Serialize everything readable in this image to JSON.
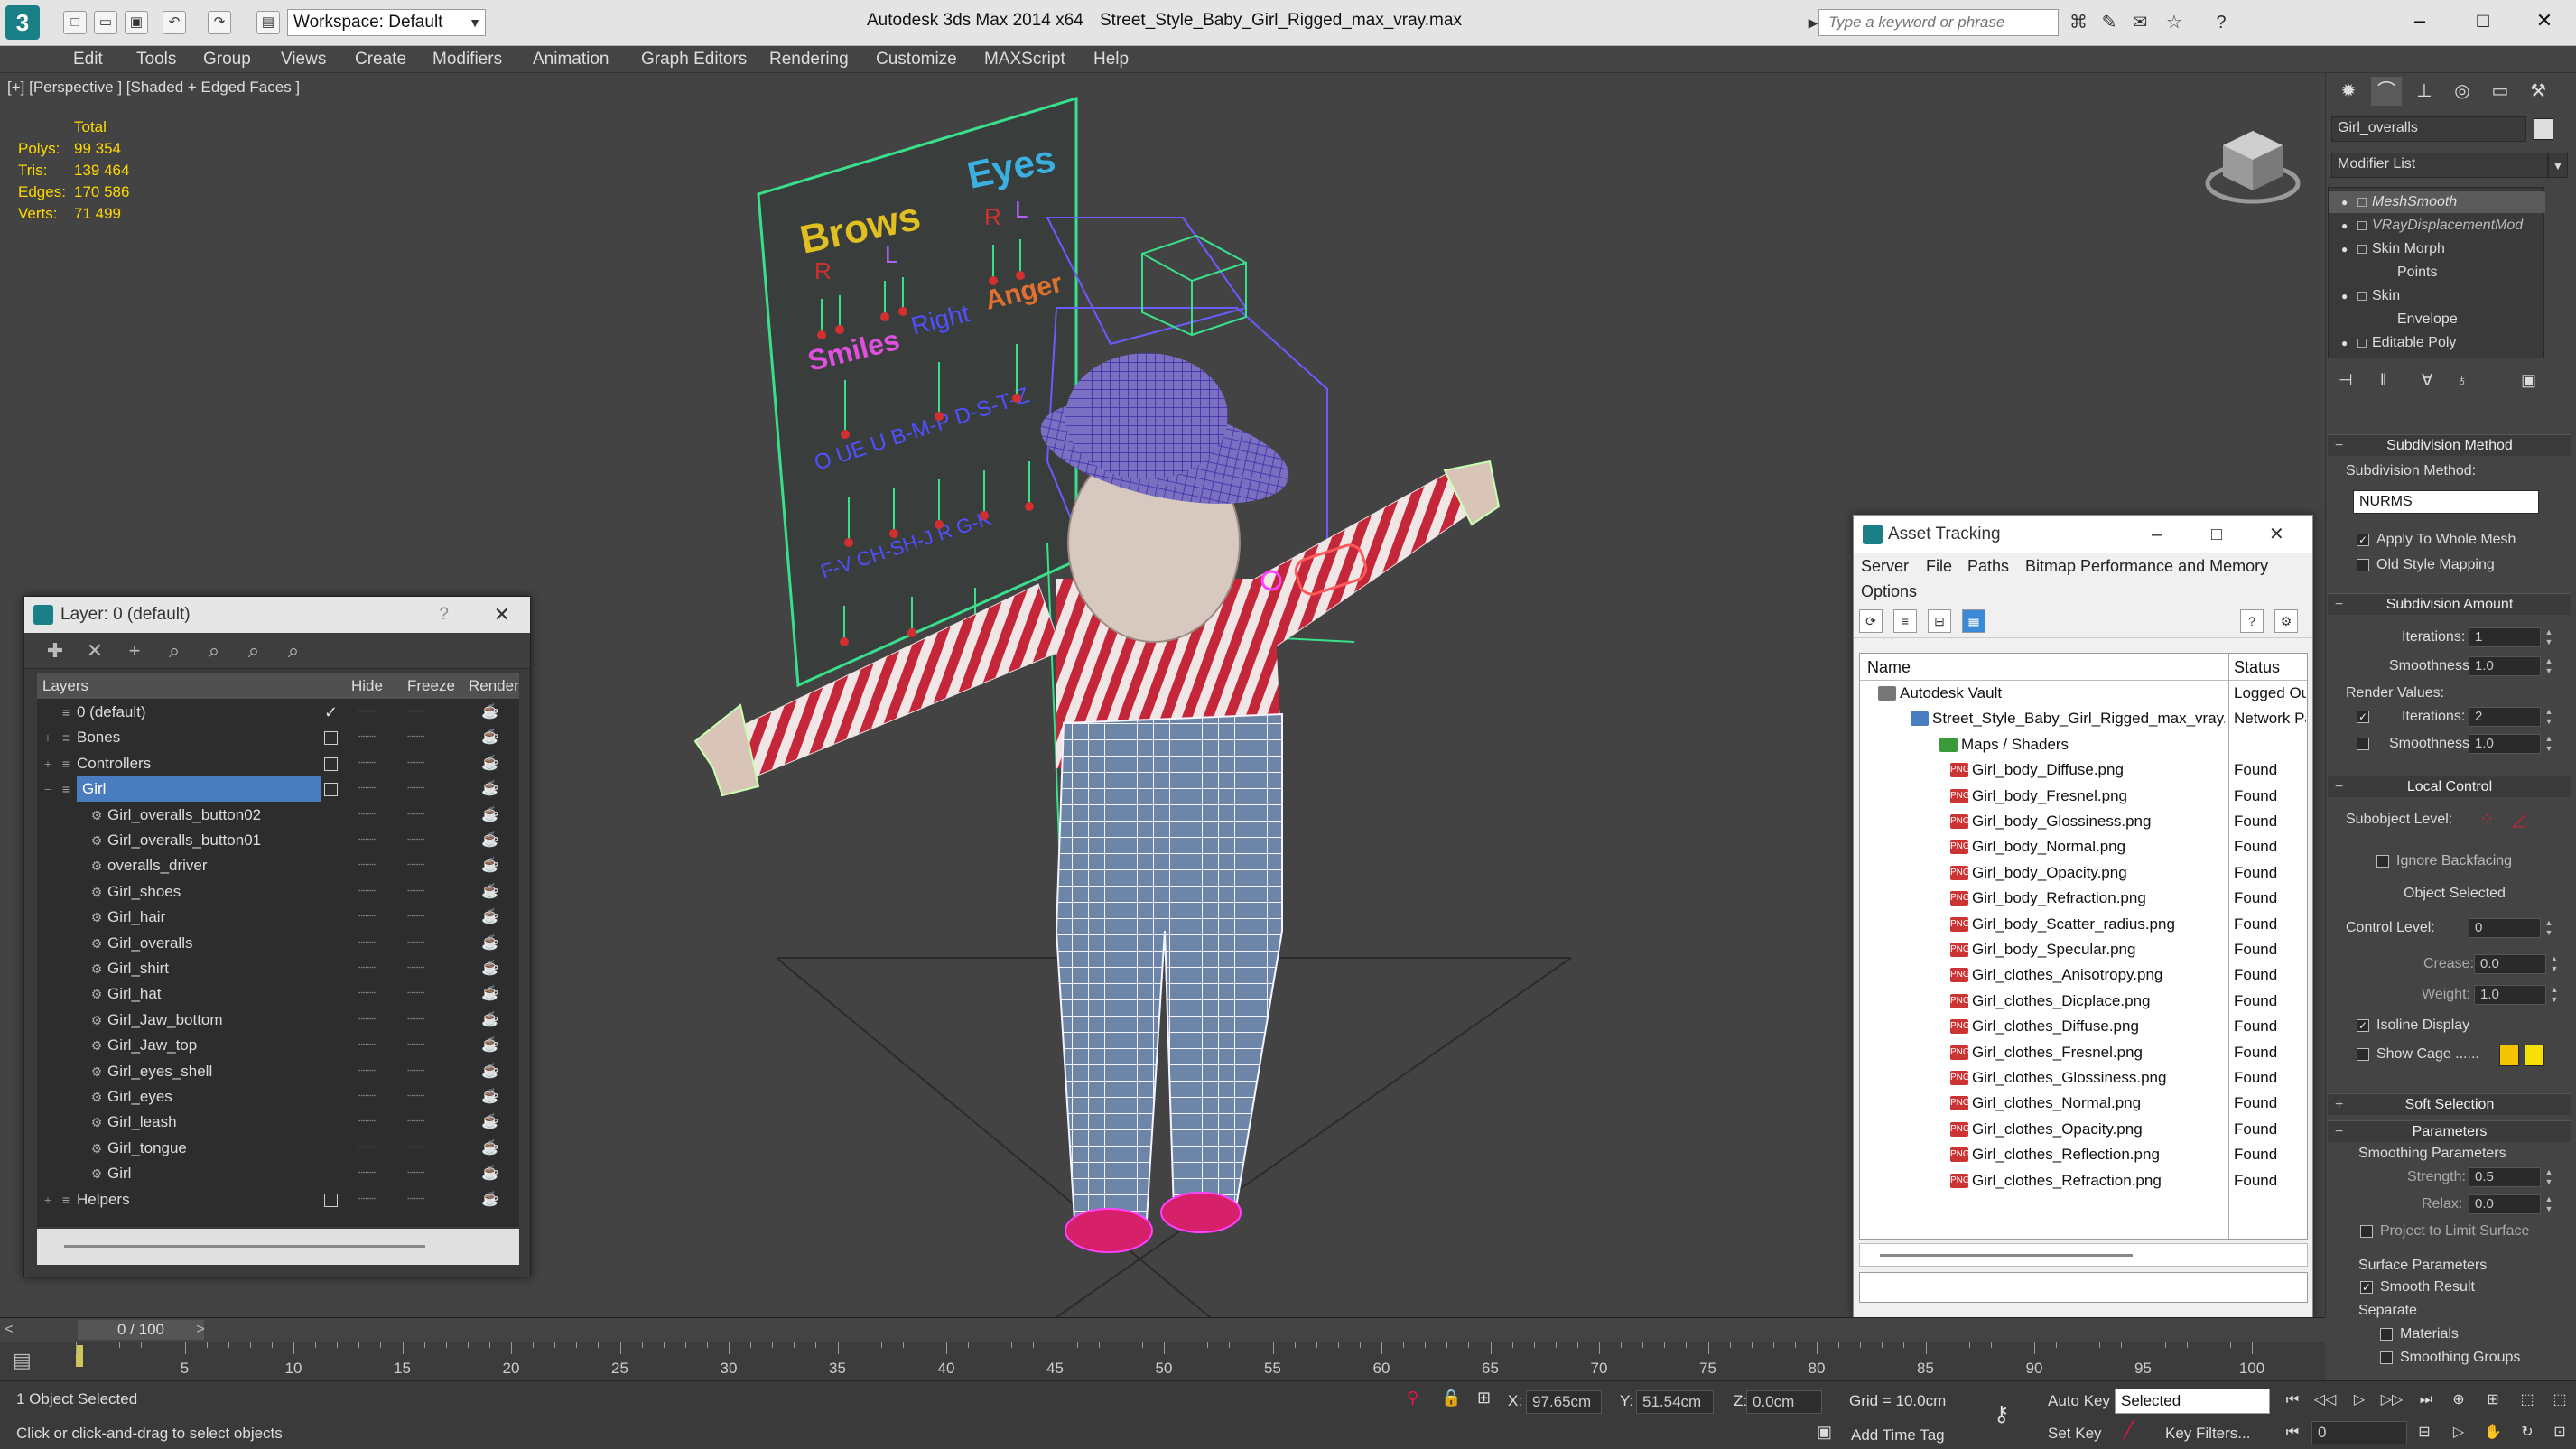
{
  "titlebar": {
    "workspace": "Workspace: Default",
    "app_title": "Autodesk 3ds Max  2014 x64",
    "file_title": "Street_Style_Baby_Girl_Rigged_max_vray.max",
    "search_placeholder": "Type a keyword or phrase"
  },
  "menu": [
    "Edit",
    "Tools",
    "Group",
    "Views",
    "Create",
    "Modifiers",
    "Animation",
    "Graph Editors",
    "Rendering",
    "Customize",
    "MAXScript",
    "Help"
  ],
  "viewport": {
    "label": "[+] [Perspective ] [Shaded + Edged Faces ]",
    "stats": {
      "total": "Total",
      "rows": [
        {
          "k": "Polys:",
          "v": "99 354"
        },
        {
          "k": "Tris:",
          "v": "139 464"
        },
        {
          "k": "Edges:",
          "v": "170 586"
        },
        {
          "k": "Verts:",
          "v": "71 499"
        }
      ]
    },
    "board": {
      "brows": "Brows",
      "eyes": "Eyes",
      "r1": "R",
      "l1": "L",
      "r2": "R",
      "l2": "L",
      "smiles": "Smiles",
      "right": "Right",
      "anger": "Anger",
      "row1": "O  UE  U   B-M-P  D-S-T-Z",
      "row2": "F-V   CH-SH-J    R   G-K"
    }
  },
  "layer_window": {
    "title": "Layer: 0 (default)",
    "help": "?",
    "close": "✕",
    "headers": {
      "layers": "Layers",
      "hide": "Hide",
      "freeze": "Freeze",
      "render": "Render"
    },
    "rows": [
      {
        "name": "0 (default)",
        "level": 0,
        "expander": "",
        "checked": true
      },
      {
        "name": "Bones",
        "level": 0,
        "expander": "+",
        "checked": false
      },
      {
        "name": "Controllers",
        "level": 0,
        "expander": "+",
        "checked": false
      },
      {
        "name": "Girl",
        "level": 0,
        "expander": "−",
        "checked": false,
        "selected": true
      },
      {
        "name": "Girl_overalls_button02",
        "level": 1
      },
      {
        "name": "Girl_overalls_button01",
        "level": 1
      },
      {
        "name": "overalls_driver",
        "level": 1
      },
      {
        "name": "Girl_shoes",
        "level": 1
      },
      {
        "name": "Girl_hair",
        "level": 1
      },
      {
        "name": "Girl_overalls",
        "level": 1
      },
      {
        "name": "Girl_shirt",
        "level": 1
      },
      {
        "name": "Girl_hat",
        "level": 1
      },
      {
        "name": "Girl_Jaw_bottom",
        "level": 1
      },
      {
        "name": "Girl_Jaw_top",
        "level": 1
      },
      {
        "name": "Girl_eyes_shell",
        "level": 1
      },
      {
        "name": "Girl_eyes",
        "level": 1
      },
      {
        "name": "Girl_leash",
        "level": 1
      },
      {
        "name": "Girl_tongue",
        "level": 1
      },
      {
        "name": "Girl",
        "level": 1
      },
      {
        "name": "Helpers",
        "level": 0,
        "expander": "+",
        "checked": false
      }
    ]
  },
  "asset_window": {
    "title": "Asset Tracking",
    "menu": [
      "Server",
      "File",
      "Paths",
      "Bitmap Performance and Memory",
      "Options"
    ],
    "headers": {
      "name": "Name",
      "status": "Status"
    },
    "rows": [
      {
        "name": "Autodesk Vault",
        "level": 0,
        "icon": "vault",
        "status": "Logged Out"
      },
      {
        "name": "Street_Style_Baby_Girl_Rigged_max_vray.max",
        "level": 1,
        "icon": "max",
        "status": "Network Path"
      },
      {
        "name": "Maps / Shaders",
        "level": 2,
        "icon": "grp",
        "status": ""
      },
      {
        "name": "Girl_body_Diffuse.png",
        "level": 3,
        "icon": "png",
        "status": "Found"
      },
      {
        "name": "Girl_body_Fresnel.png",
        "level": 3,
        "icon": "png",
        "status": "Found"
      },
      {
        "name": "Girl_body_Glossiness.png",
        "level": 3,
        "icon": "png",
        "status": "Found"
      },
      {
        "name": "Girl_body_Normal.png",
        "level": 3,
        "icon": "png",
        "status": "Found"
      },
      {
        "name": "Girl_body_Opacity.png",
        "level": 3,
        "icon": "png",
        "status": "Found"
      },
      {
        "name": "Girl_body_Refraction.png",
        "level": 3,
        "icon": "png",
        "status": "Found"
      },
      {
        "name": "Girl_body_Scatter_radius.png",
        "level": 3,
        "icon": "png",
        "status": "Found"
      },
      {
        "name": "Girl_body_Specular.png",
        "level": 3,
        "icon": "png",
        "status": "Found"
      },
      {
        "name": "Girl_clothes_Anisotropy.png",
        "level": 3,
        "icon": "png",
        "status": "Found"
      },
      {
        "name": "Girl_clothes_Dicplace.png",
        "level": 3,
        "icon": "png",
        "status": "Found"
      },
      {
        "name": "Girl_clothes_Diffuse.png",
        "level": 3,
        "icon": "png",
        "status": "Found"
      },
      {
        "name": "Girl_clothes_Fresnel.png",
        "level": 3,
        "icon": "png",
        "status": "Found"
      },
      {
        "name": "Girl_clothes_Glossiness.png",
        "level": 3,
        "icon": "png",
        "status": "Found"
      },
      {
        "name": "Girl_clothes_Normal.png",
        "level": 3,
        "icon": "png",
        "status": "Found"
      },
      {
        "name": "Girl_clothes_Opacity.png",
        "level": 3,
        "icon": "png",
        "status": "Found"
      },
      {
        "name": "Girl_clothes_Reflection.png",
        "level": 3,
        "icon": "png",
        "status": "Found"
      },
      {
        "name": "Girl_clothes_Refraction.png",
        "level": 3,
        "icon": "png",
        "status": "Found"
      }
    ]
  },
  "command_panel": {
    "object_name": "Girl_overalls",
    "modifier_list": "Modifier List",
    "stack": [
      {
        "label": "MeshSmooth",
        "indent": 0,
        "style": "first"
      },
      {
        "label": "VRayDisplacementMod",
        "indent": 0,
        "style": "sec"
      },
      {
        "label": "Skin Morph",
        "indent": 0,
        "style": ""
      },
      {
        "label": "Points",
        "indent": 1,
        "style": ""
      },
      {
        "label": "Skin",
        "indent": 0,
        "style": ""
      },
      {
        "label": "Envelope",
        "indent": 1,
        "style": ""
      },
      {
        "label": "Editable Poly",
        "indent": 0,
        "style": ""
      }
    ],
    "subdivision_method_title": "Subdivision Method",
    "subdivision_method_label": "Subdivision Method:",
    "subdivision_method_value": "NURMS",
    "apply_to_whole_mesh": "Apply To Whole Mesh",
    "old_style_mapping": "Old Style Mapping",
    "subdivision_amount_title": "Subdivision Amount",
    "iterations_label": "Iterations:",
    "iterations_value": "1",
    "smoothness_label": "Smoothness:",
    "smoothness_value": "1.0",
    "render_values": "Render Values:",
    "render_iterations_label": "Iterations:",
    "render_iterations_value": "2",
    "render_smoothness_label": "Smoothness:",
    "render_smoothness_value": "1.0",
    "local_control_title": "Local Control",
    "subobject_level": "Subobject Level:",
    "ignore_backfacing": "Ignore Backfacing",
    "object_selected": "Object Selected",
    "control_level_label": "Control Level:",
    "control_level_value": "0",
    "crease_label": "Crease:",
    "crease_value": "0.0",
    "weight_label": "Weight:",
    "weight_value": "1.0",
    "isoline_display": "Isoline Display",
    "show_cage": "Show Cage ......",
    "cage_color_1": "#f5c400",
    "cage_color_2": "#f5e000",
    "soft_selection_title": "Soft Selection",
    "parameters_title": "Parameters",
    "smoothing_parameters": "Smoothing Parameters",
    "strength_label": "Strength:",
    "strength_value": "0.5",
    "relax_label": "Relax:",
    "relax_value": "0.0",
    "project_to_limit": "Project to Limit Surface",
    "surface_parameters": "Surface Parameters",
    "smooth_result": "Smooth Result",
    "separate": "Separate",
    "materials": "Materials",
    "smoothing_groups": "Smoothing Groups"
  },
  "timeline": {
    "frame": "0 / 100",
    "ticks": [
      5,
      10,
      15,
      20,
      25,
      30,
      35,
      40,
      45,
      50,
      55,
      60,
      65,
      70,
      75,
      80,
      85,
      90,
      95,
      100
    ]
  },
  "statusbar": {
    "objects_selected": "1 Object Selected",
    "prompt": "Click or click-and-drag to select objects",
    "x_label": "X:",
    "x_value": "97.65cm",
    "y_label": "Y:",
    "y_value": "51.54cm",
    "z_label": "Z:",
    "z_value": "0.0cm",
    "grid": "Grid = 10.0cm",
    "add_time_tag": "Add Time Tag",
    "auto_key": "Auto Key",
    "set_key": "Set Key",
    "selected": "Selected",
    "key_filters": "Key Filters...",
    "frame_field": "0"
  }
}
